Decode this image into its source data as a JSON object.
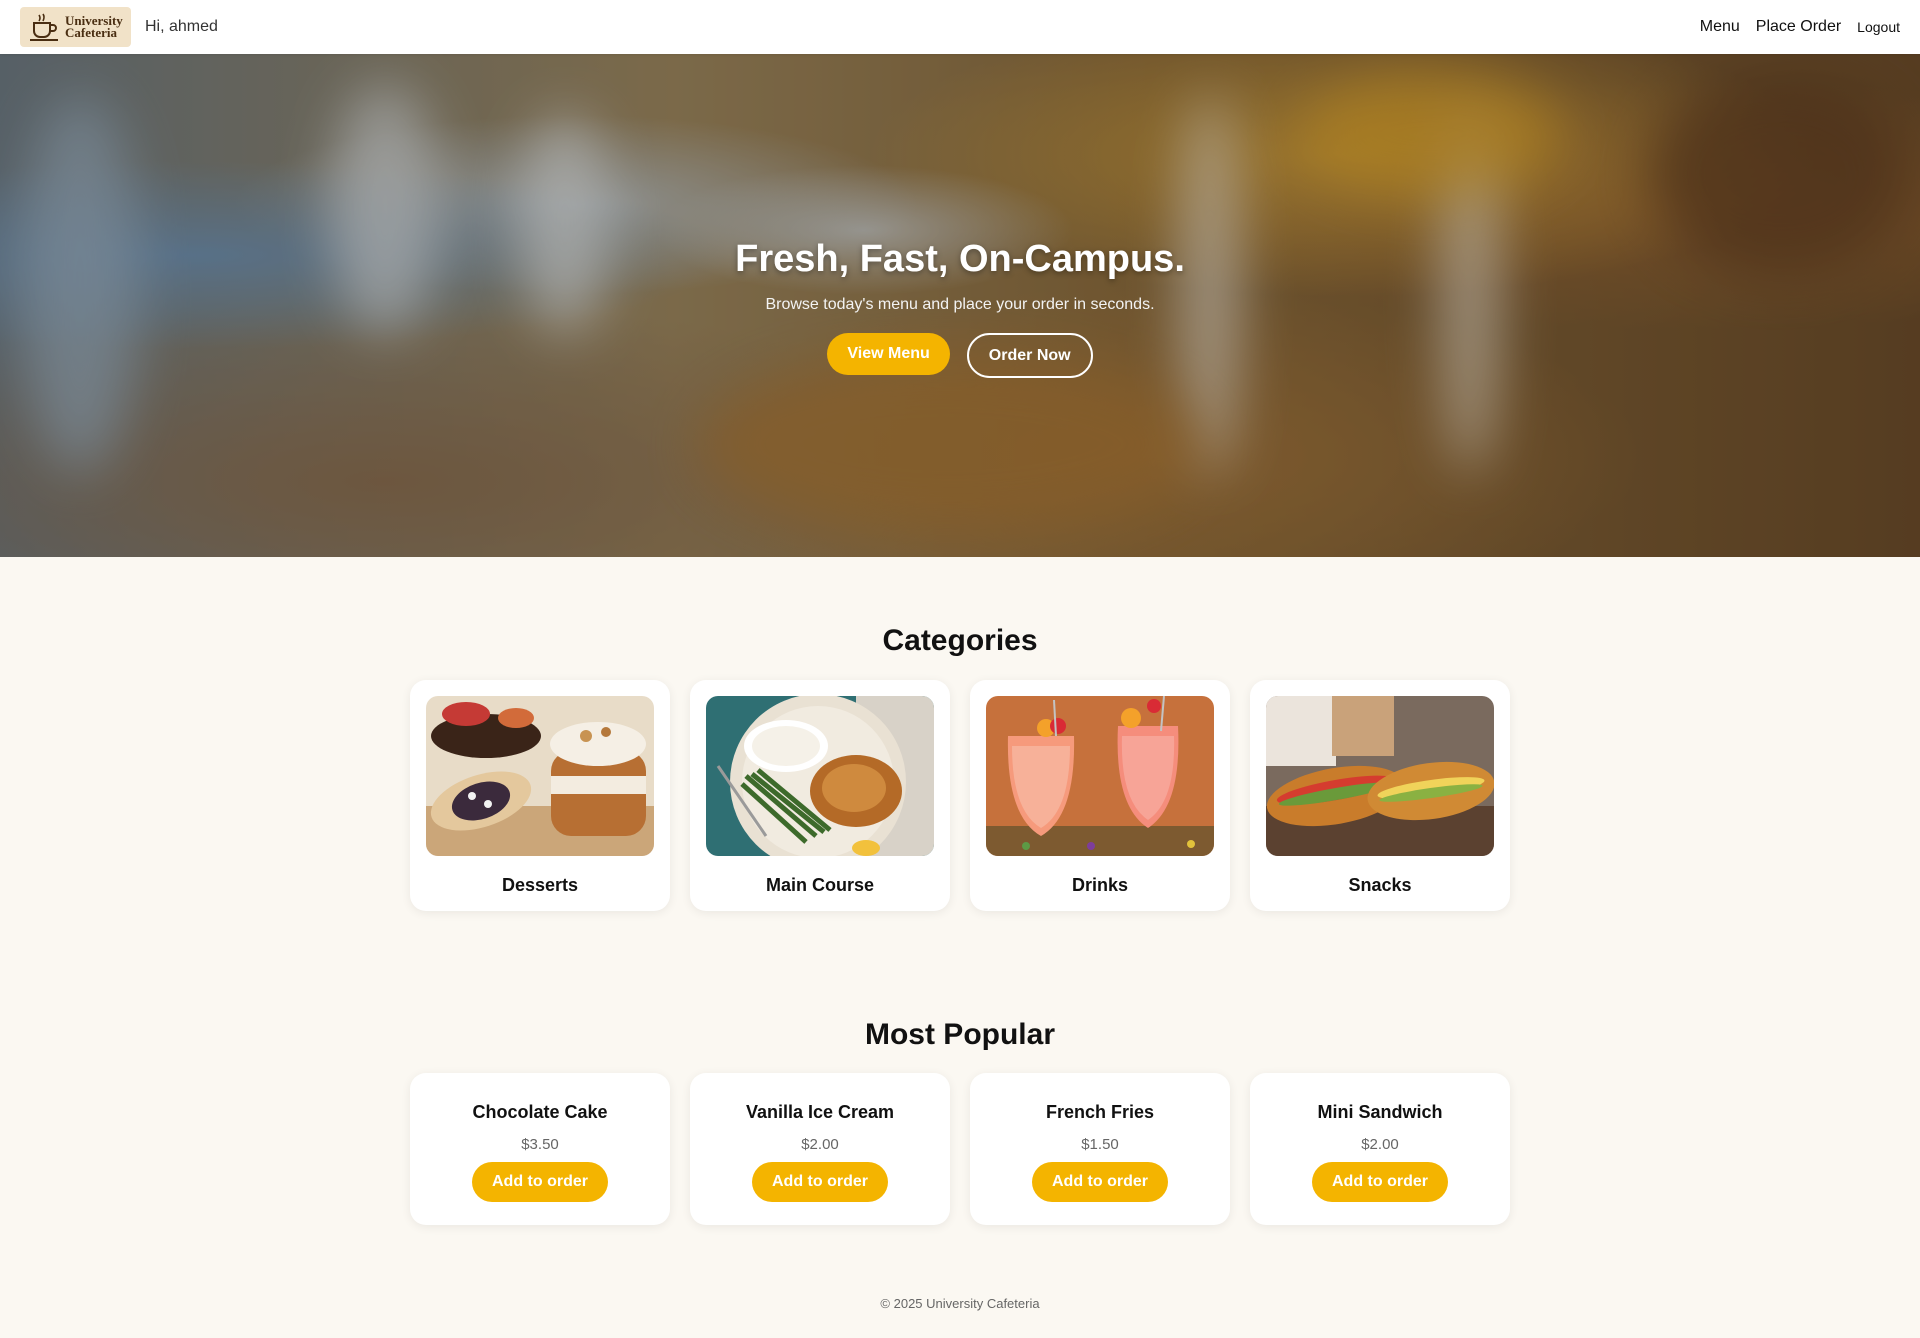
{
  "header": {
    "logo_line1": "University",
    "logo_line2": "Cafeteria",
    "greeting": "Hi, ahmed",
    "nav": {
      "menu": "Menu",
      "place_order": "Place Order",
      "logout": "Logout"
    }
  },
  "hero": {
    "title": "Fresh, Fast, On-Campus.",
    "subtitle": "Browse today's menu and place your order in seconds.",
    "primary_button": "View Menu",
    "secondary_button": "Order Now"
  },
  "categories": {
    "title": "Categories",
    "items": [
      {
        "label": "Desserts",
        "icon": "desserts-photo"
      },
      {
        "label": "Main Course",
        "icon": "main-course-photo"
      },
      {
        "label": "Drinks",
        "icon": "drinks-photo"
      },
      {
        "label": "Snacks",
        "icon": "snacks-photo"
      }
    ]
  },
  "popular": {
    "title": "Most Popular",
    "add_label": "Add to order",
    "items": [
      {
        "name": "Chocolate Cake",
        "price": "$3.50"
      },
      {
        "name": "Vanilla Ice Cream",
        "price": "$2.00"
      },
      {
        "name": "French Fries",
        "price": "$1.50"
      },
      {
        "name": "Mini Sandwich",
        "price": "$2.00"
      }
    ]
  },
  "footer": {
    "text": "© 2025 University Cafeteria"
  },
  "colors": {
    "accent": "#f4b400",
    "background": "#fbf8f2",
    "navbar": "#ffffff"
  }
}
